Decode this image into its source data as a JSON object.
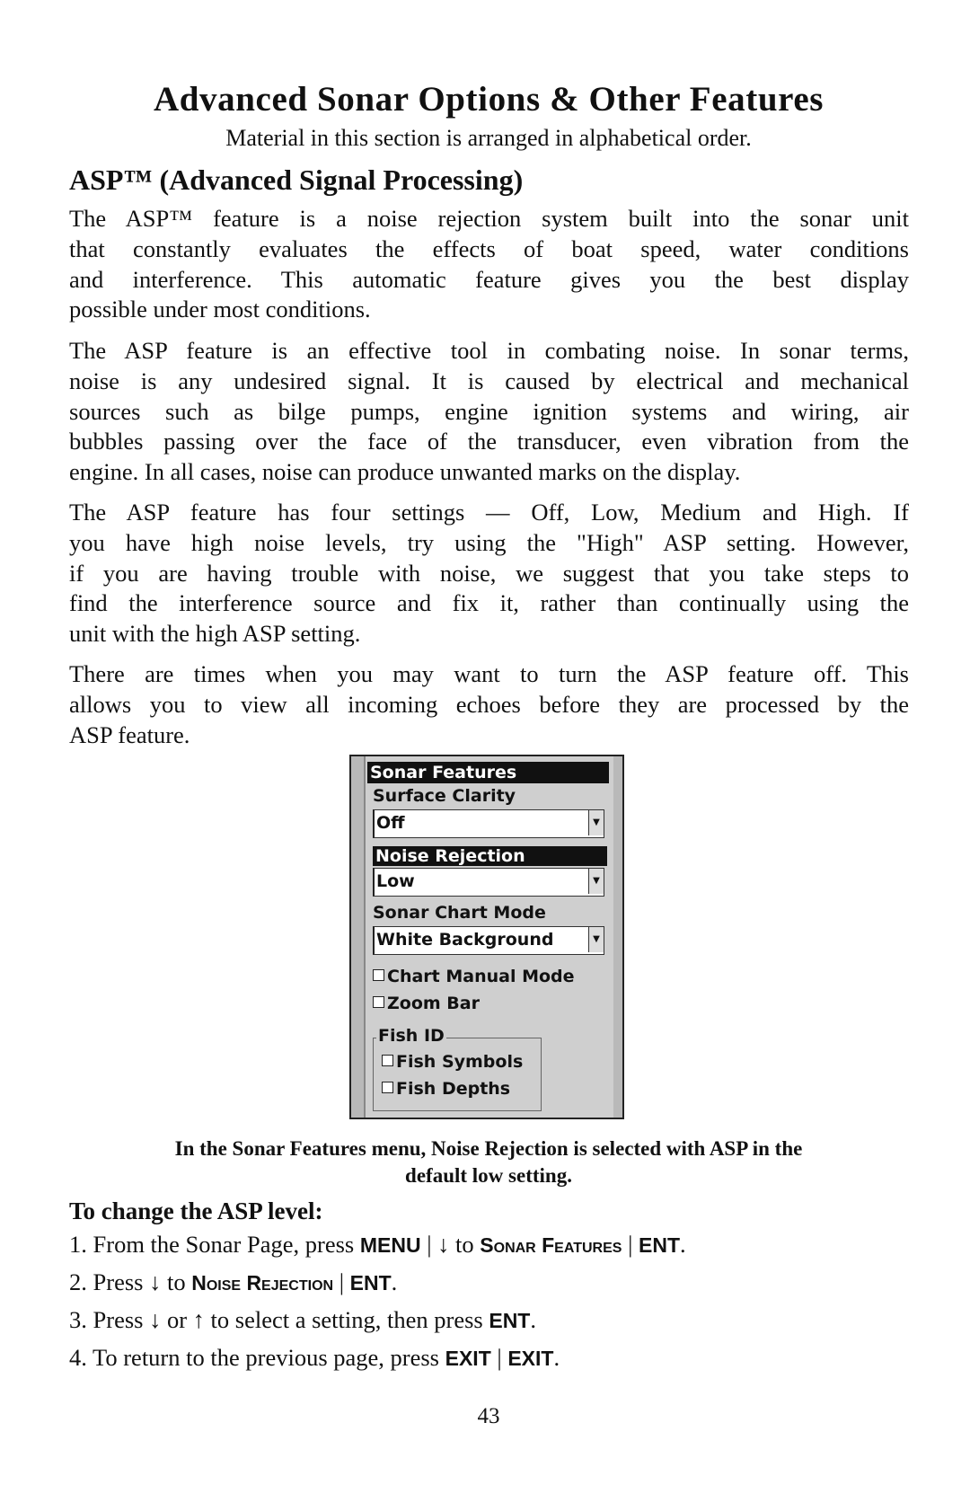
{
  "title": "Advanced Sonar Options & Other Features",
  "subtitle": "Material in this section is arranged in alphabetical order.",
  "section_heading": "ASP™ (Advanced Signal Processing)",
  "paragraphs": [
    [
      "The ASP™ feature is a noise rejection system built into the sonar unit",
      "that constantly evaluates the effects of boat speed, water conditions",
      "and interference. This automatic feature gives you the best display",
      "possible under most conditions."
    ],
    [
      "The ASP feature is an effective tool in combating noise. In sonar terms,",
      "noise is any undesired signal. It is caused by electrical and mechanical",
      "sources such as bilge pumps, engine ignition systems and wiring, air",
      "bubbles passing over the face of the transducer, even vibration from the",
      "engine. In all cases, noise can produce unwanted marks on the display."
    ],
    [
      "The ASP feature has four settings — Off, Low, Medium and High. If",
      "you have high noise levels, try using the \"High\" ASP setting. However,",
      "if you are having trouble with noise, we suggest that you take steps to",
      "find the interference source and fix it, rather than continually using the",
      "unit with the high ASP setting."
    ],
    [
      "There are times when you may want to turn the ASP feature off. This",
      "allows you to view all incoming echoes before they are processed by the",
      "ASP feature."
    ]
  ],
  "screenshot": {
    "menu_title": "Sonar Features",
    "surface_clarity_label": "Surface Clarity",
    "surface_clarity_value": "Off",
    "noise_rejection_label": "Noise Rejection",
    "noise_rejection_value": "Low",
    "chart_mode_label": "Sonar Chart Mode",
    "chart_mode_value": "White Background",
    "chart_manual_mode": "Chart Manual Mode",
    "zoom_bar": "Zoom Bar",
    "fish_id_label": "Fish ID",
    "fish_symbols": "Fish Symbols",
    "fish_depths": "Fish Depths",
    "checkboxes_checked": false
  },
  "caption": [
    "In the Sonar Features menu, Noise Rejection is selected with ASP in the",
    "default low setting."
  ],
  "steps_heading": "To change the ASP level:",
  "steps": {
    "s1": {
      "a": "1. From the Sonar Page, press ",
      "k1": "MENU",
      "sep": " | ",
      "down": "↓",
      "b": " to ",
      "k2": "Sonar Features",
      "k3": "ENT",
      "end": "."
    },
    "s2": {
      "a": "2. Press ",
      "down": "↓",
      "b": " to ",
      "k1": "Noise Rejection",
      "sep": " | ",
      "k2": "ENT",
      "end": "."
    },
    "s3": {
      "a": "3. Press ",
      "down": "↓",
      "b": " or ",
      "up": "↑",
      "c": " to select a setting, then press ",
      "k1": "ENT",
      "end": "."
    },
    "s4": {
      "a": "4. To return to the previous page, press ",
      "k1": "EXIT",
      "sep": " | ",
      "k2": "EXIT",
      "end": "."
    }
  },
  "page_number": "43"
}
